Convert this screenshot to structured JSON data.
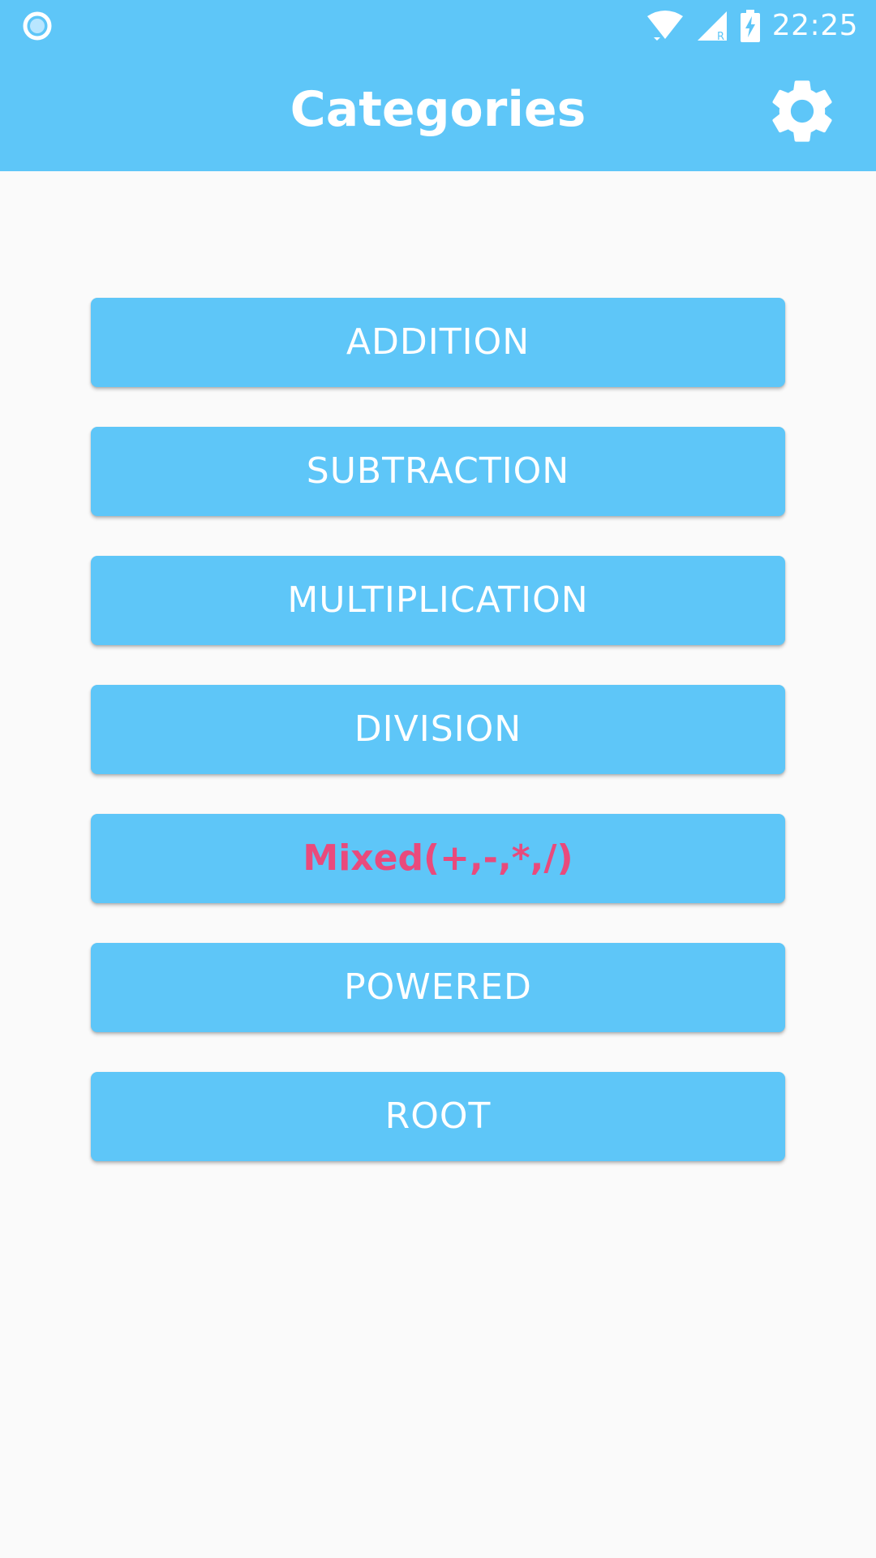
{
  "colors": {
    "primary": "#5EC6F8",
    "background": "#FAFAFA",
    "on_primary": "#FFFFFF",
    "accent": "#E94A7C"
  },
  "status_bar": {
    "time": "22:25",
    "icons": [
      "notification-circle-icon",
      "wifi-icon",
      "cell-signal-icon",
      "battery-charging-icon"
    ]
  },
  "app_bar": {
    "title": "Categories",
    "settings_icon": "gear-icon"
  },
  "categories": [
    {
      "label": "ADDITION",
      "accent": false
    },
    {
      "label": "SUBTRACTION",
      "accent": false
    },
    {
      "label": "MULTIPLICATION",
      "accent": false
    },
    {
      "label": "DIVISION",
      "accent": false
    },
    {
      "label": "Mixed(+,-,*,/)",
      "accent": true
    },
    {
      "label": "POWERED",
      "accent": false
    },
    {
      "label": "ROOT",
      "accent": false
    }
  ]
}
